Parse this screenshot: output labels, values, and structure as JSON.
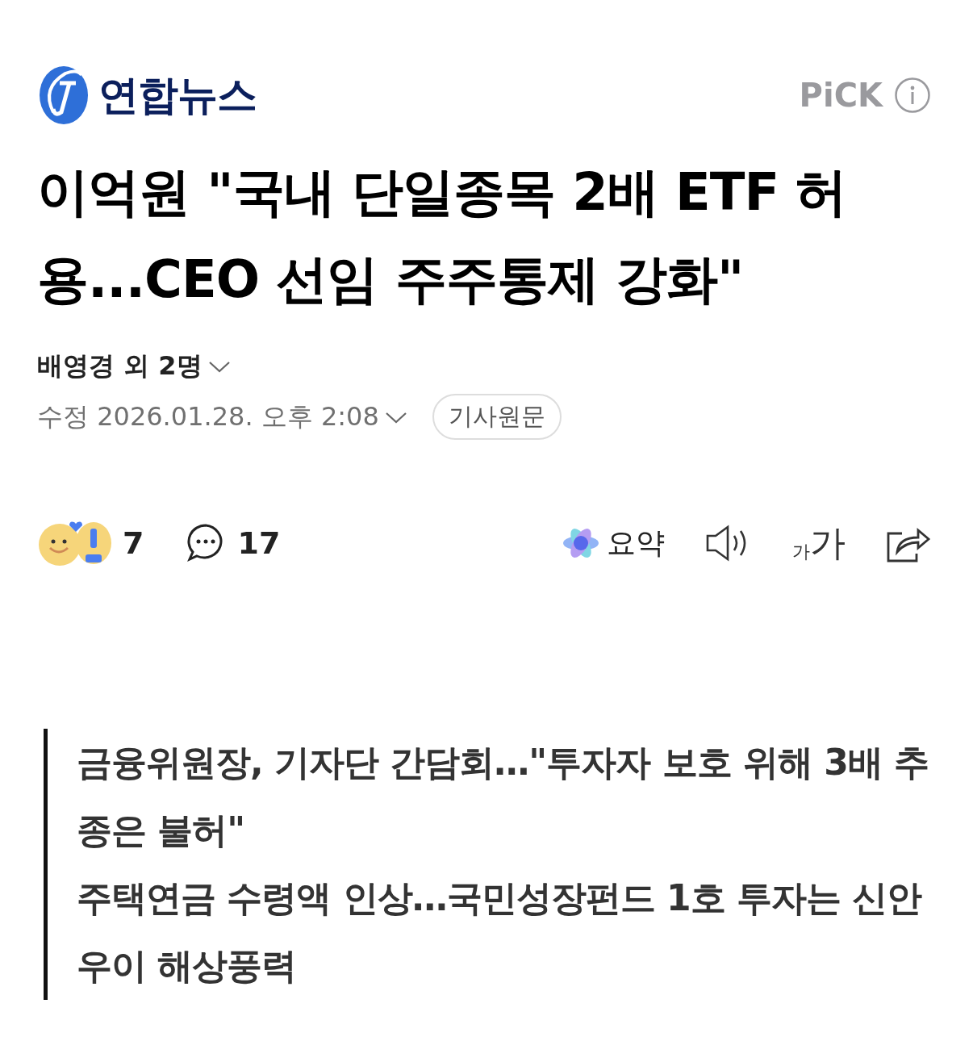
{
  "header": {
    "logo_text": "연합뉴스",
    "pick": "PiCK"
  },
  "headline": "이억원 \"국내 단일종목 2배 ETF 허용...CEO 선임 주주통제 강화\"",
  "byline": {
    "authors": "배영경 외 2명",
    "date": "수정 2026.01.28. 오후 2:08",
    "original_button": "기사원문"
  },
  "actions": {
    "reactions": "7",
    "comments": "17",
    "summary": "요약",
    "font_small": "가",
    "font_large": "가"
  },
  "related": [
    "금융위원장, 기자단 간담회…\"투자자 보호 위해 3배 추종은 불허\"",
    "주택연금 수령액 인상…국민성장펀드 1호 투자는 신안우이 해상풍력"
  ]
}
